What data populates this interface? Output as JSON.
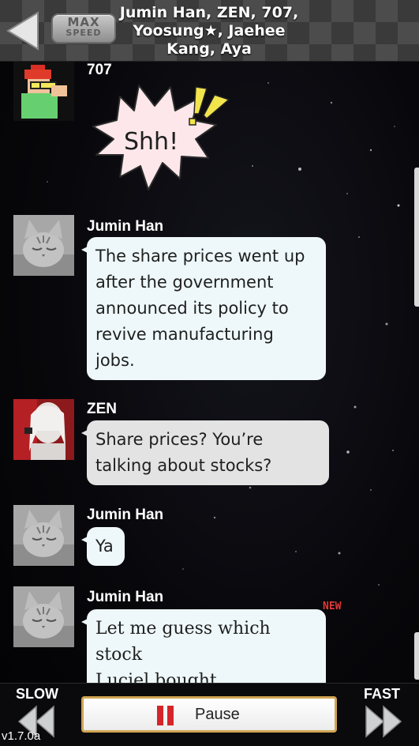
{
  "header": {
    "title_lines": [
      "Jumin Han, ZEN, 707,",
      "Yoosung★, Jaehee",
      "Kang, Aya"
    ],
    "speed_top": "MAX",
    "speed_bottom": "SPEED"
  },
  "messages": [
    {
      "sender": "707",
      "type": "emoticon",
      "text": "Shh!",
      "avatar": "707-pixel-avatar"
    },
    {
      "sender": "Jumin Han",
      "type": "text",
      "text_lines": [
        "The share prices went up",
        "after the government",
        "announced its policy to",
        "revive manufacturing",
        "jobs."
      ],
      "avatar": "cat-avatar"
    },
    {
      "sender": "ZEN",
      "type": "text",
      "text_lines": [
        "Share prices? You’re",
        "talking about stocks?"
      ],
      "avatar": "zen-avatar"
    },
    {
      "sender": "Jumin Han",
      "type": "text",
      "text_lines": [
        "Ya"
      ],
      "avatar": "cat-avatar"
    },
    {
      "sender": "Jumin Han",
      "type": "text",
      "text_lines": [
        "Let me guess which stock",
        "Luciel bought."
      ],
      "avatar": "cat-avatar",
      "badge": "NEW"
    }
  ],
  "footer": {
    "slow_label": "SLOW",
    "fast_label": "FAST",
    "pause_label": "Pause",
    "version": "v1.7.0a"
  },
  "colors": {
    "bubble_blue": "#eef8fa",
    "bubble_gray": "#e3e3e3",
    "pause_red": "#d5252a",
    "new_badge": "#e23a3a",
    "pause_border": "#d0a552"
  }
}
